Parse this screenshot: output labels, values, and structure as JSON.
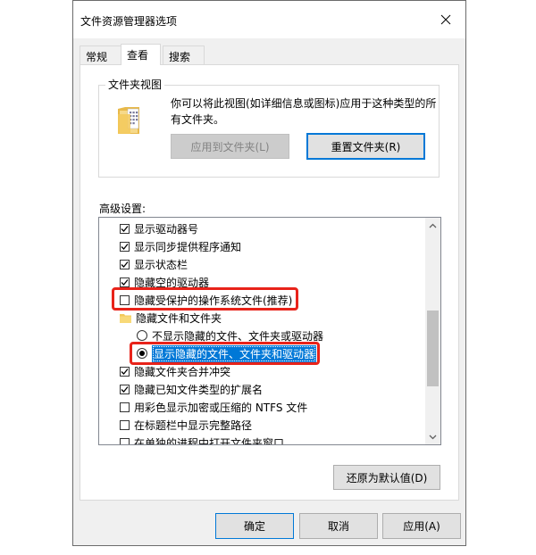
{
  "window": {
    "title": "文件资源管理器选项"
  },
  "tabs": [
    {
      "label": "常规",
      "active": false
    },
    {
      "label": "查看",
      "active": true
    },
    {
      "label": "搜索",
      "active": false
    }
  ],
  "folder_views": {
    "group_label": "文件夹视图",
    "description": "你可以将此视图(如详细信息或图标)应用于这种类型的所有文件夹。",
    "apply_button": "应用到文件夹(L)",
    "reset_button": "重置文件夹(R)"
  },
  "advanced": {
    "label": "高级设置:",
    "items": [
      {
        "type": "checkbox",
        "label": "显示驱动器号",
        "checked": true
      },
      {
        "type": "checkbox",
        "label": "显示同步提供程序通知",
        "checked": true
      },
      {
        "type": "checkbox",
        "label": "显示状态栏",
        "checked": true
      },
      {
        "type": "checkbox",
        "label": "隐藏空的驱动器",
        "checked": true
      },
      {
        "type": "checkbox",
        "label": "隐藏受保护的操作系统文件(推荐)",
        "checked": false
      },
      {
        "type": "folder",
        "label": "隐藏文件和文件夹"
      },
      {
        "type": "radio",
        "label": "不显示隐藏的文件、文件夹或驱动器",
        "checked": false
      },
      {
        "type": "radio",
        "label": "显示隐藏的文件、文件夹和驱动器",
        "checked": true,
        "selected": true
      },
      {
        "type": "checkbox",
        "label": "隐藏文件夹合并冲突",
        "checked": true
      },
      {
        "type": "checkbox",
        "label": "隐藏已知文件类型的扩展名",
        "checked": true
      },
      {
        "type": "checkbox",
        "label": "用彩色显示加密或压缩的 NTFS 文件",
        "checked": false
      },
      {
        "type": "checkbox",
        "label": "在标题栏中显示完整路径",
        "checked": false
      },
      {
        "type": "checkbox",
        "label": "在单独的进程中打开文件夹窗口",
        "checked": false
      }
    ],
    "restore_button": "还原为默认值(D)"
  },
  "footer": {
    "ok": "确定",
    "cancel": "取消",
    "apply": "应用(A)"
  },
  "colors": {
    "highlight": "#e8231a",
    "selection": "#0078d7"
  }
}
